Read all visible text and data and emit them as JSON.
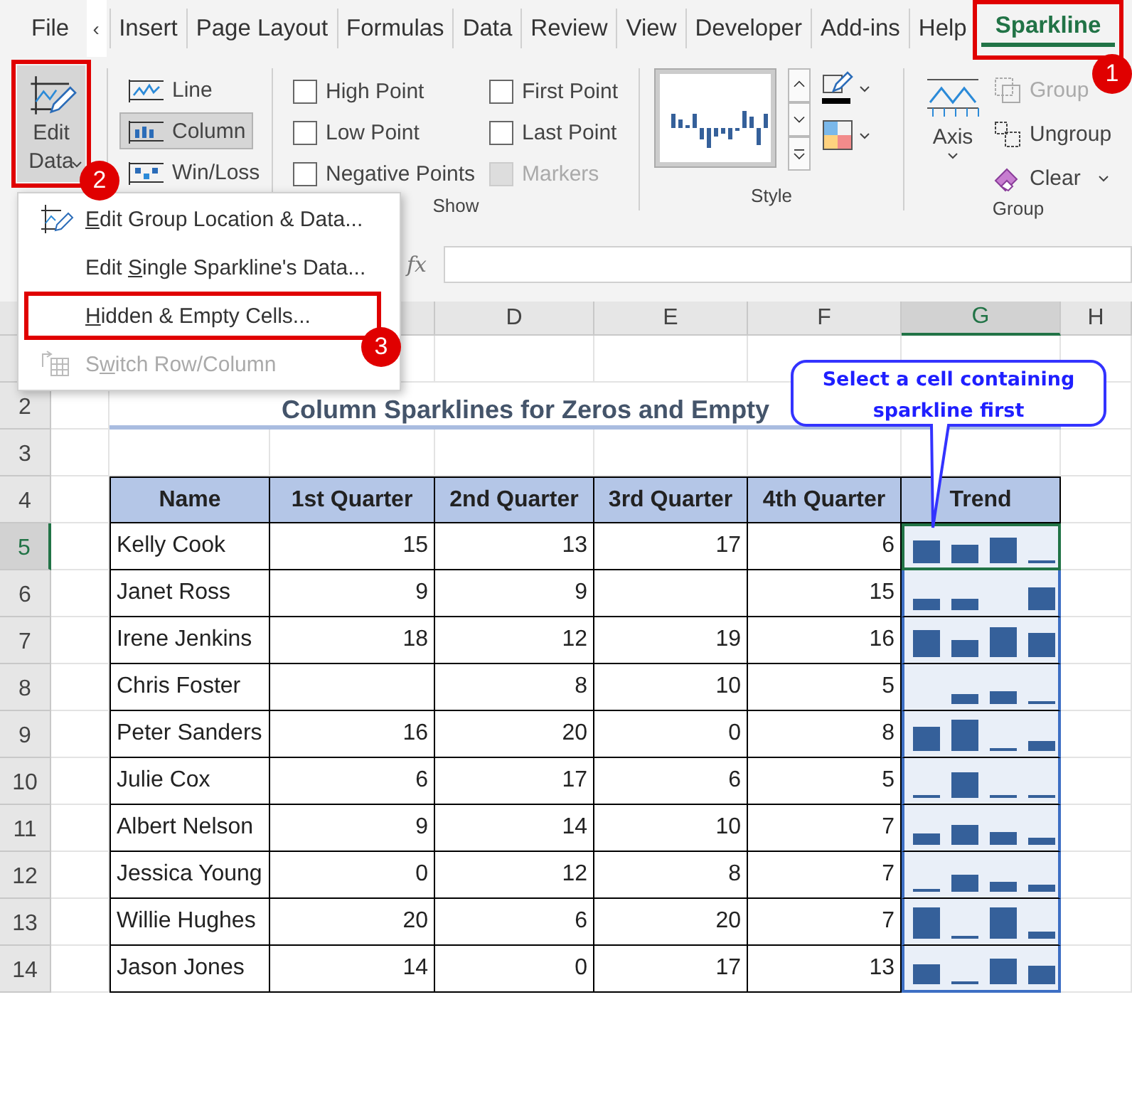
{
  "tabs": [
    {
      "label": "File",
      "selected": false
    },
    {
      "label": "Insert",
      "selected": false
    },
    {
      "label": "Page Layout",
      "selected": false
    },
    {
      "label": "Formulas",
      "selected": false
    },
    {
      "label": "Data",
      "selected": false
    },
    {
      "label": "Review",
      "selected": false
    },
    {
      "label": "View",
      "selected": false
    },
    {
      "label": "Developer",
      "selected": false
    },
    {
      "label": "Add-ins",
      "selected": false
    },
    {
      "label": "Help",
      "selected": false
    },
    {
      "label": "Sparkline",
      "selected": true
    }
  ],
  "tab_scroll": "‹",
  "ribbon": {
    "edit_data": "Edit Data",
    "types": [
      {
        "label": "Line",
        "selected": false,
        "kind": "line"
      },
      {
        "label": "Column",
        "selected": true,
        "kind": "column"
      },
      {
        "label": "Win/Loss",
        "selected": false,
        "kind": "winloss"
      }
    ],
    "show_label": "Show",
    "show_options": [
      {
        "label": "High Point",
        "checked": false,
        "disabled": false
      },
      {
        "label": "Low Point",
        "checked": false,
        "disabled": false
      },
      {
        "label": "Negative Points",
        "checked": false,
        "disabled": false
      },
      {
        "label": "First Point",
        "checked": false,
        "disabled": false
      },
      {
        "label": "Last Point",
        "checked": false,
        "disabled": false
      },
      {
        "label": "Markers",
        "checked": false,
        "disabled": true
      }
    ],
    "style_label": "Style",
    "axis": "Axis",
    "group_buttons": [
      {
        "label": "Group",
        "disabled": true,
        "kind": "group"
      },
      {
        "label": "Ungroup",
        "disabled": false,
        "kind": "ungroup"
      },
      {
        "label": "Clear",
        "disabled": false,
        "kind": "clear"
      }
    ],
    "group_label": "Group"
  },
  "menu": [
    {
      "key": "E",
      "after": "dit Group Location & Data...",
      "kind": "chart",
      "disabled": false,
      "highlighted": false
    },
    {
      "before": "Edit ",
      "key": "S",
      "after": "ingle Sparkline's Data...",
      "kind": "text",
      "disabled": false,
      "highlighted": false
    },
    {
      "key": "H",
      "after": "idden & Empty Cells...",
      "kind": "text",
      "disabled": false,
      "highlighted": true
    },
    {
      "before": "S",
      "key": "w",
      "after": "itch Row/Column",
      "kind": "switch",
      "disabled": true,
      "highlighted": false
    }
  ],
  "steps": [
    "1",
    "2",
    "3"
  ],
  "formula_bar": {
    "function_label": "fx"
  },
  "column_headers": [
    {
      "label": "D",
      "selected": false
    },
    {
      "label": "E",
      "selected": false
    },
    {
      "label": "F",
      "selected": false
    },
    {
      "label": "G",
      "selected": true
    },
    {
      "label": "H",
      "selected": false
    }
  ],
  "row_numbers": [
    {
      "label": "2",
      "selected": false
    },
    {
      "label": "3",
      "selected": false
    },
    {
      "label": "4",
      "selected": false
    },
    {
      "label": "5",
      "selected": true
    },
    {
      "label": "6",
      "selected": false
    },
    {
      "label": "7",
      "selected": false
    },
    {
      "label": "8",
      "selected": false
    },
    {
      "label": "9",
      "selected": false
    },
    {
      "label": "10",
      "selected": false
    },
    {
      "label": "11",
      "selected": false
    },
    {
      "label": "12",
      "selected": false
    },
    {
      "label": "13",
      "selected": false
    },
    {
      "label": "14",
      "selected": false
    }
  ],
  "sheet_title": "Column Sparklines for Zeros and Empty",
  "table": {
    "columns": [
      "Name",
      "1st Quarter",
      "2nd Quarter",
      "3rd Quarter",
      "4th Quarter",
      "Trend"
    ],
    "rows": [
      {
        "cells": [
          "Kelly Cook",
          "15",
          "13",
          "17",
          "6"
        ],
        "selected": true
      },
      {
        "cells": [
          "Janet Ross",
          "9",
          "9",
          "",
          "15"
        ],
        "selected": false
      },
      {
        "cells": [
          "Irene Jenkins",
          "18",
          "12",
          "19",
          "16"
        ],
        "selected": false
      },
      {
        "cells": [
          "Chris Foster",
          "",
          "8",
          "10",
          "5"
        ],
        "selected": false
      },
      {
        "cells": [
          "Peter Sanders",
          "16",
          "20",
          "0",
          "8"
        ],
        "selected": false
      },
      {
        "cells": [
          "Julie Cox",
          "6",
          "17",
          "6",
          "5"
        ],
        "selected": false
      },
      {
        "cells": [
          "Albert Nelson",
          "9",
          "14",
          "10",
          "7"
        ],
        "selected": false
      },
      {
        "cells": [
          "Jessica Young",
          "0",
          "12",
          "8",
          "7"
        ],
        "selected": false
      },
      {
        "cells": [
          "Willie Hughes",
          "20",
          "6",
          "20",
          "7"
        ],
        "selected": false
      },
      {
        "cells": [
          "Jason Jones",
          "14",
          "0",
          "17",
          "13"
        ],
        "selected": false
      }
    ]
  },
  "callout": "Select a cell containing sparkline first"
}
